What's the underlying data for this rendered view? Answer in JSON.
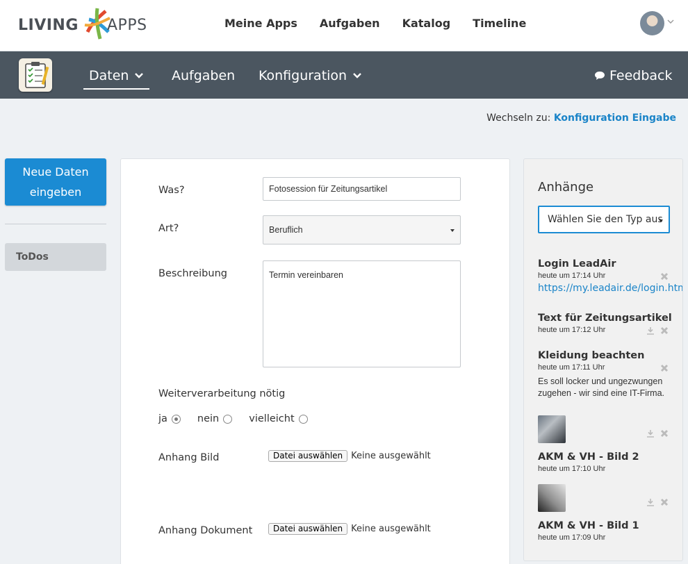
{
  "brand": {
    "living": "LIVING",
    "apps": "APPS"
  },
  "topnav": [
    "Meine Apps",
    "Aufgaben",
    "Katalog",
    "Timeline"
  ],
  "appnav": {
    "daten": "Daten",
    "aufgaben": "Aufgaben",
    "konfiguration": "Konfiguration",
    "feedback": "Feedback"
  },
  "switch": {
    "prefix": "Wechseln zu:",
    "link": "Konfiguration Eingabe"
  },
  "sidebar": {
    "new_button_line1": "Neue Daten",
    "new_button_line2": "eingeben",
    "todos": "ToDos"
  },
  "form": {
    "was_label": "Was?",
    "was_value": "Fotosession für Zeitungsartikel",
    "art_label": "Art?",
    "art_value": "Beruflich",
    "beschreibung_label": "Beschreibung",
    "beschreibung_value": "Termin vereinbaren",
    "weiter_label": "Weiterverarbeitung nötig",
    "radio_options": [
      "ja",
      "nein",
      "vielleicht"
    ],
    "radio_selected": "ja",
    "bild_label": "Anhang Bild",
    "dokument_label": "Anhang Dokument",
    "file_button": "Datei auswählen",
    "file_status": "Keine ausgewählt"
  },
  "attachments": {
    "title": "Anhänge",
    "type_select": "Wählen Sie den Typ aus",
    "items": [
      {
        "name": "Login LeadAir",
        "time": "heute um 17:14 Uhr",
        "link": "https://my.leadair.de/login.htm"
      },
      {
        "name": "Text für Zeitungsartikel",
        "time": "heute um 17:12 Uhr"
      },
      {
        "name": "Kleidung beachten",
        "time": "heute um 17:11 Uhr",
        "desc": "Es soll locker und ungezwungen zugehen - wir sind eine IT-Firma."
      },
      {
        "name": "AKM & VH - Bild 2",
        "time": "heute um 17:10 Uhr"
      },
      {
        "name": "AKM & VH - Bild 1",
        "time": "heute um 17:09 Uhr"
      }
    ]
  },
  "colors": {
    "accent": "#1b8bd3",
    "darkbar": "#4b5660",
    "link": "#1a84c8"
  }
}
